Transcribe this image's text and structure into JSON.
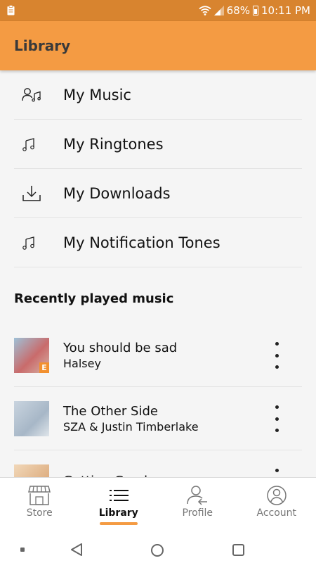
{
  "status_bar": {
    "battery": "68%",
    "time": "10:11 PM"
  },
  "app_bar": {
    "title": "Library"
  },
  "menu": {
    "items": [
      {
        "label": "My Music",
        "icon": "user-music-icon"
      },
      {
        "label": "My Ringtones",
        "icon": "music-note-icon"
      },
      {
        "label": "My Downloads",
        "icon": "download-icon"
      },
      {
        "label": "My Notification Tones",
        "icon": "music-note-icon"
      }
    ]
  },
  "recent": {
    "title": "Recently played music",
    "tracks": [
      {
        "title": "You should be sad",
        "artist": "Halsey",
        "badge": "E"
      },
      {
        "title": "The Other Side",
        "artist": "SZA & Justin Timberlake"
      },
      {
        "title": "Getting Good",
        "artist": ""
      }
    ]
  },
  "bottom_nav": {
    "items": [
      {
        "label": "Store",
        "icon": "store-icon"
      },
      {
        "label": "Library",
        "icon": "list-icon"
      },
      {
        "label": "Profile",
        "icon": "profile-icon"
      },
      {
        "label": "Account",
        "icon": "account-icon"
      }
    ],
    "active": "Library"
  },
  "colors": {
    "status_bar": "#d8842f",
    "app_bar": "#f49b43",
    "accent": "#f49b43",
    "explicit_badge": "#f2902f"
  }
}
